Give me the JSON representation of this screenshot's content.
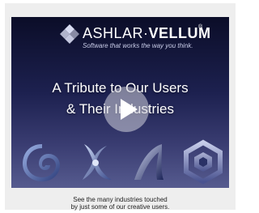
{
  "video": {
    "brand_prefix": "ASHLAR·",
    "brand_suffix": "VELLUM",
    "trademark": "®",
    "tagline": "Software that works the way you think.",
    "title_line1": "A Tribute to Our Users",
    "title_line2": "& Their Industries"
  },
  "caption": {
    "line1": "See the many industries touched",
    "line2": "by just some of our creative users."
  },
  "icons": [
    "swirl-logo-icon",
    "propeller-icon",
    "fin-icon",
    "hexagon-logo-icon"
  ],
  "colors": {
    "background": "#ffffff",
    "panel": "#eeeeee",
    "video_dark": "#0b0d28",
    "video_light": "#565b8f"
  }
}
